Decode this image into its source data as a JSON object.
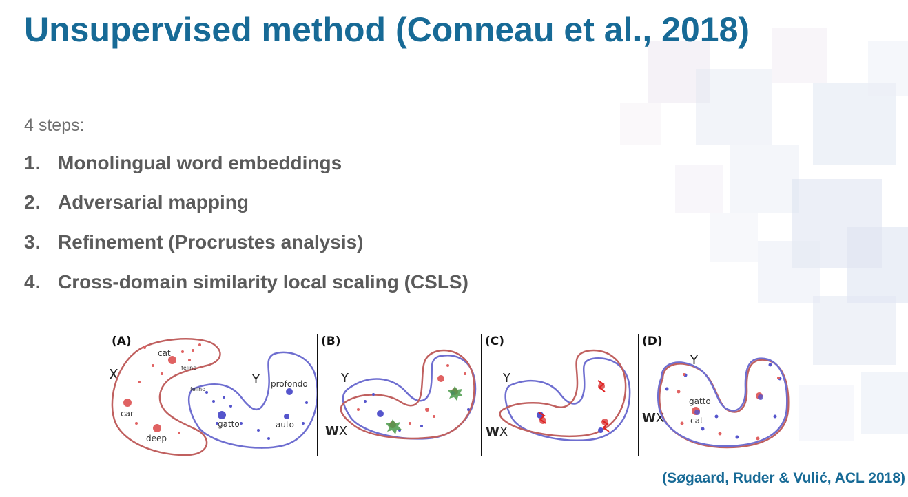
{
  "slide": {
    "title": "Unsupervised method (Conneau et al., 2018)",
    "intro": "4 steps:",
    "steps": [
      {
        "num": "1.",
        "text": "Monolingual word embeddings"
      },
      {
        "num": "2.",
        "text": "Adversarial mapping"
      },
      {
        "num": "3.",
        "text": "Refinement (Procrustes analysis)"
      },
      {
        "num": "4.",
        "text": "Cross-domain similarity local scaling (CSLS)"
      }
    ],
    "citation": "(Søgaard, Ruder & Vulić, ACL 2018)"
  },
  "figure": {
    "panels": [
      {
        "label": "(A)",
        "x_label": "X",
        "y_label": "Y",
        "words": [
          "cat",
          "feline",
          "car",
          "deep",
          "felino",
          "gatto",
          "profondo",
          "auto"
        ]
      },
      {
        "label": "(B)",
        "y_label": "Y",
        "wx_bold": "W",
        "wx_rest": "X"
      },
      {
        "label": "(C)",
        "y_label": "Y",
        "wx_bold": "W",
        "wx_rest": "X"
      },
      {
        "label": "(D)",
        "y_label": "Y",
        "wx_bold": "W",
        "wx_rest": "X",
        "words": [
          "gatto",
          "cat"
        ]
      }
    ]
  },
  "colors": {
    "title": "#176a96",
    "body_text": "#5b5b5b",
    "intro_text": "#6f6f6f",
    "red_space": "#c0605f",
    "blue_space": "#6e6ed0",
    "red_point": "#e06262",
    "blue_point": "#5555cc"
  }
}
